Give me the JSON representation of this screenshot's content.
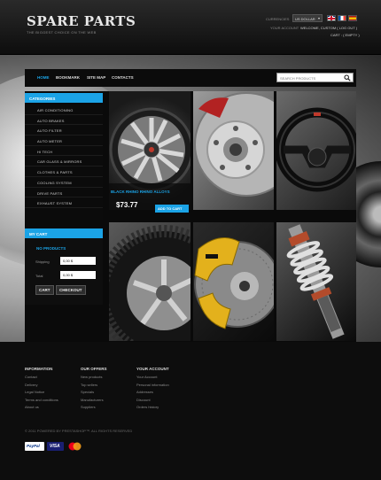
{
  "header": {
    "logo": "SPARE PARTS",
    "tagline": "THE BIGGEST CHOICE ON THE WEB",
    "currencies_label": "CURRENCIES",
    "currency_selected": "US DOLLAR",
    "account_label": "YOUR ACCOUNT",
    "welcome_text": "WELCOME, CUSTOM ( LOG OUT )",
    "cart_text": "CART :  ( EMPTY )"
  },
  "nav": {
    "items": [
      "HOME",
      "BOOKMARK",
      "SITE MAP",
      "CONTACTS"
    ],
    "active": "HOME",
    "search_placeholder": "SEARCH PRODUCTS"
  },
  "categories": {
    "title": "CATEGORIES",
    "items": [
      "AIR CONDITIONING",
      "AUTO BRAKES",
      "AUTO FILTER",
      "AUTO METER",
      "HI TECH",
      "CAR GLASS & MIRRORS",
      "CLOTHES & PARTS",
      "COOLING SYSTEM",
      "DRIVE PARTS",
      "EXHAUST SYSTEM"
    ]
  },
  "cart": {
    "title": "MY CART",
    "count_text": "NO PRODUCTS",
    "shipping_label": "Shipping",
    "shipping_value": "0,00 $",
    "total_label": "Total",
    "total_value": "0,00 $",
    "cart_button": "CART",
    "checkout_button": "CHECKOUT"
  },
  "featured": {
    "name": "BLACK RHINO RHINO ALLOYS",
    "price": "$73.77",
    "add_button": "ADD TO CART"
  },
  "footer": {
    "columns": [
      {
        "heading": "INFORMATION",
        "links": [
          "Contact",
          "Delivery",
          "Legal Notice",
          "Terms and conditions",
          "About us"
        ]
      },
      {
        "heading": "OUR OFFERS",
        "links": [
          "New products",
          "Top sellers",
          "Specials",
          "Manufacturers",
          "Suppliers"
        ]
      },
      {
        "heading": "YOUR ACCOUNT",
        "links": [
          "Your Account",
          "Personal information",
          "Addresses",
          "Discount",
          "Orders history"
        ]
      }
    ],
    "copyright": "© 2011 POWERED BY PRESTASHOP™. ALL RIGHTS RESERVED",
    "payment": {
      "paypal": "PayPal",
      "visa": "VISA",
      "mastercard": "mastercard-icon"
    }
  },
  "colors": {
    "accent": "#1ba3e6"
  }
}
